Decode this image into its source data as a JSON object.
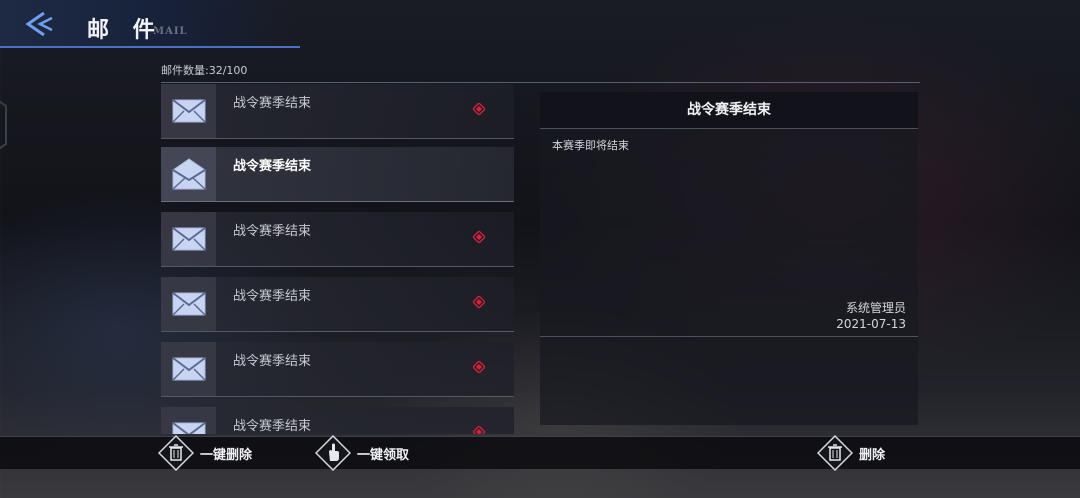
{
  "header": {
    "title": "邮 件",
    "subtitle": "MAIL"
  },
  "mail_count": {
    "label": "邮件数量:32/100"
  },
  "mails": [
    {
      "subject": "战令赛季结束",
      "state": "unread",
      "icon": "closed-envelope-icon"
    },
    {
      "subject": "战令赛季结束",
      "state": "read-selected",
      "icon": "open-envelope-icon"
    },
    {
      "subject": "战令赛季结束",
      "state": "unread",
      "icon": "closed-envelope-icon"
    },
    {
      "subject": "战令赛季结束",
      "state": "unread",
      "icon": "closed-envelope-icon"
    },
    {
      "subject": "战令赛季结束",
      "state": "unread",
      "icon": "closed-envelope-icon"
    },
    {
      "subject": "战令赛季结束",
      "state": "unread",
      "icon": "closed-envelope-icon"
    }
  ],
  "detail": {
    "title": "战令赛季结束",
    "body": "本赛季即将结束",
    "sender": "系统管理员",
    "date": "2021-07-13"
  },
  "actions": {
    "delete_all": "一键删除",
    "claim_all": "一键领取",
    "delete": "删除"
  },
  "colors": {
    "accent_blue": "#4a72c4",
    "unread_red": "#e0203a",
    "envelope": "#c7d4f2"
  }
}
